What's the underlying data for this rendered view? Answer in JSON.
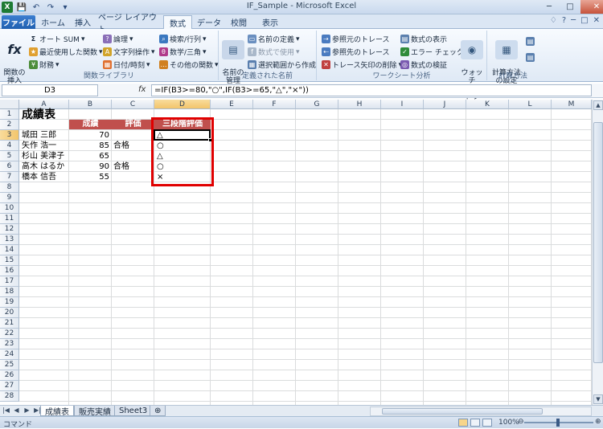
{
  "window": {
    "title": "IF_Sample - Microsoft Excel",
    "controls": [
      "─",
      "□",
      "✕"
    ]
  },
  "qat": {
    "logo": "X",
    "save": "💾",
    "undo": "↶",
    "redo": "↷",
    "customize": "▾"
  },
  "ribbon": {
    "tabs": [
      "ファイル",
      "ホーム",
      "挿入",
      "ページ レイアウト",
      "数式",
      "データ",
      "校閲",
      "表示"
    ],
    "active_tab": "数式",
    "right_controls": [
      "♢",
      "?",
      "─",
      "□",
      "✕"
    ],
    "groups": {
      "library": {
        "label": "関数ライブラリ",
        "insert_function": "関数の\n挿入",
        "autosum": "オート SUM",
        "recent": "最近使用した関数",
        "financial": "財務",
        "logical": "論理",
        "text": "文字列操作",
        "datetime": "日付/時刻",
        "lookup": "検索/行列",
        "math": "数学/三角",
        "other": "その他の関数"
      },
      "names": {
        "label": "定義された名前",
        "manager": "名前の\n管理",
        "define": "名前の定義",
        "use": "数式で使用",
        "create": "選択範囲から作成"
      },
      "audit": {
        "label": "ワークシート分析",
        "trace_precedents": "参照元のトレース",
        "trace_dependents": "参照先のトレース",
        "remove_arrows": "トレース矢印の削除",
        "show_formulas": "数式の表示",
        "error_check": "エラー チェック",
        "evaluate": "数式の検証",
        "watch": "ウォッチ\nウィンドウ"
      },
      "calc": {
        "label": "計算方法",
        "options": "計算方法\nの設定"
      }
    }
  },
  "formula_bar": {
    "name_box": "D3",
    "fx": "fx",
    "formula": "=IF(B3>=80,\"○\",IF(B3>=65,\"△\",\"×\"))"
  },
  "grid": {
    "columns": [
      "A",
      "B",
      "C",
      "D",
      "E",
      "F",
      "G",
      "H",
      "I",
      "J",
      "K",
      "L",
      "M"
    ],
    "rows": [
      "1",
      "2",
      "3",
      "4",
      "5",
      "6",
      "7",
      "8",
      "9",
      "10",
      "11",
      "12",
      "13",
      "14",
      "15",
      "16",
      "17",
      "18",
      "19",
      "20",
      "21",
      "22",
      "23",
      "24",
      "25",
      "26",
      "27",
      "28"
    ],
    "selected_col": "D",
    "selected_row": "3",
    "title": "成績表",
    "headers": [
      "成績",
      "評価",
      "三段階評価"
    ],
    "data": [
      {
        "name": "城田 三郎",
        "score": "70",
        "eval": "",
        "grade": "△"
      },
      {
        "name": "矢作 浩一",
        "score": "85",
        "eval": "合格",
        "grade": "○"
      },
      {
        "name": "杉山 美津子",
        "score": "65",
        "eval": "",
        "grade": "△"
      },
      {
        "name": "高木 はるか",
        "score": "90",
        "eval": "合格",
        "grade": "○"
      },
      {
        "name": "橋本 信吾",
        "score": "55",
        "eval": "",
        "grade": "×"
      }
    ],
    "highlight_color": "#e00000",
    "header_fill": "#c0504d"
  },
  "sheets": {
    "nav": [
      "|◀",
      "◀",
      "▶",
      "▶|"
    ],
    "tabs": [
      "成績表",
      "販売実績",
      "Sheet3"
    ],
    "active": "成績表",
    "new_sheet": "⊕"
  },
  "status": {
    "mode": "コマンド",
    "zoom": "100%",
    "zoom_minus": "⊖",
    "zoom_plus": "⊕"
  }
}
